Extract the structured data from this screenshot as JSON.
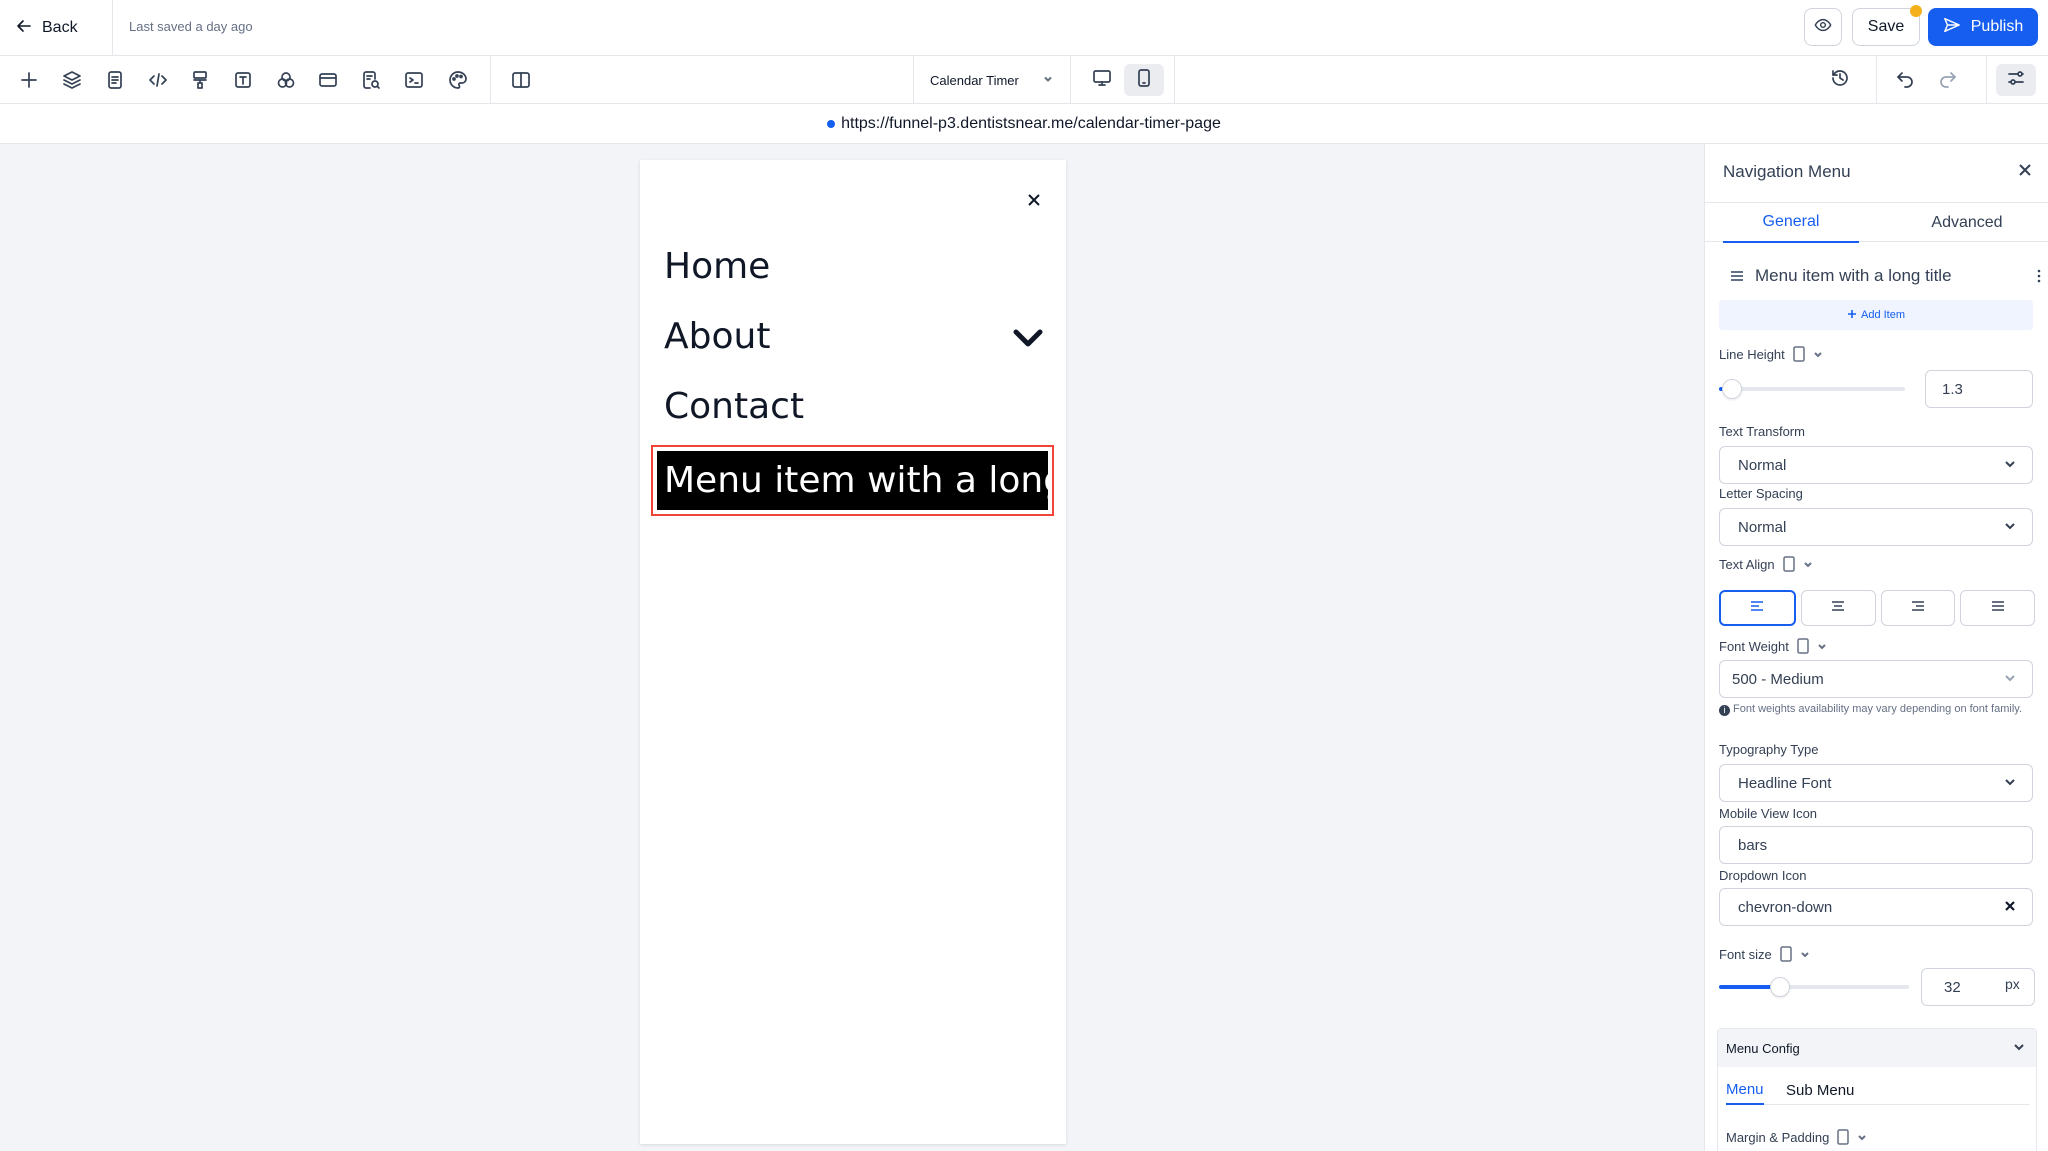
{
  "topbar": {
    "back_label": "Back",
    "last_saved": "Last saved a day ago",
    "save_label": "Save",
    "publish_label": "Publish"
  },
  "toolbar": {
    "page_selector": "Calendar Timer",
    "tools": [
      "plus-icon",
      "layers-icon",
      "page-icon",
      "code-icon",
      "paint-roller-icon",
      "text-box-icon",
      "shapes-icon",
      "browser-icon",
      "page-search-icon",
      "terminal-icon",
      "palette-icon",
      "columns-icon"
    ],
    "active_device": "mobile"
  },
  "url": {
    "text": "https://funnel-p3.dentistsnear.me/calendar-timer-page",
    "status_color": "#155eef"
  },
  "preview": {
    "menu_items": [
      "Home",
      "About",
      "Contact"
    ],
    "selected_item": "Menu item with a long title",
    "selection_color": "#f04438"
  },
  "panel": {
    "title": "Navigation Menu",
    "tabs": [
      "General",
      "Advanced"
    ],
    "active_tab": "General",
    "menu_item_title": "Menu item with a long title",
    "add_item_label": "Add Item",
    "line_height": {
      "label": "Line Height",
      "value": "1.3",
      "slider_fraction": 0.05
    },
    "text_transform": {
      "label": "Text Transform",
      "value": "Normal"
    },
    "letter_spacing": {
      "label": "Letter Spacing",
      "value": "Normal"
    },
    "text_align": {
      "label": "Text Align",
      "active": "left"
    },
    "font_weight": {
      "label": "Font Weight",
      "value": "500 - Medium",
      "note": "Font weights availability may vary depending on font family."
    },
    "typography_type": {
      "label": "Typography Type",
      "value": "Headline Font"
    },
    "mobile_view_icon": {
      "label": "Mobile View Icon",
      "value": "bars"
    },
    "dropdown_icon": {
      "label": "Dropdown Icon",
      "value": "chevron-down"
    },
    "font_size": {
      "label": "Font size",
      "value": "32",
      "unit": "px",
      "slider_fraction": 0.3
    },
    "menu_config": {
      "title": "Menu Config",
      "tabs": [
        "Menu",
        "Sub Menu"
      ],
      "active_tab": "Menu",
      "margin_padding_label": "Margin & Padding"
    }
  },
  "colors": {
    "accent": "#155eef",
    "save_indicator": "#f5b11b"
  }
}
